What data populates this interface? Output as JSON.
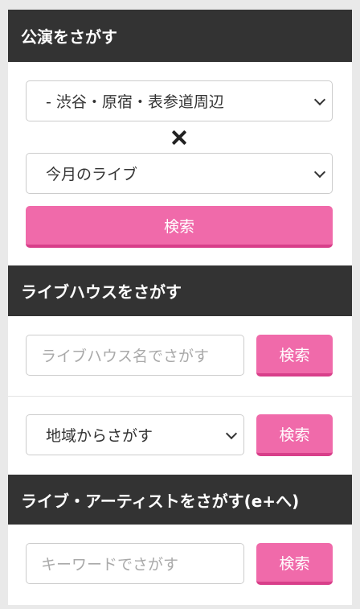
{
  "performance_search": {
    "header": "公演をさがす",
    "area_select": "- 渋谷・原宿・表参道周辺",
    "cross_icon": "times-icon",
    "period_select": "今月のライブ",
    "search_button": "検索"
  },
  "livehouse_search": {
    "header": "ライブハウスをさがす",
    "name_input_placeholder": "ライブハウス名でさがす",
    "name_search_button": "検索",
    "region_select": "地域からさがす",
    "region_search_button": "検索"
  },
  "artist_search": {
    "header": "ライブ・アーティストをさがす(e+へ)",
    "keyword_input_placeholder": "キーワードでさがす",
    "search_button": "検索"
  },
  "colors": {
    "header_bg": "#333333",
    "accent_pink": "#f06aaa",
    "accent_pink_shadow": "#d83f8a",
    "page_bg": "#e9e9e9"
  }
}
